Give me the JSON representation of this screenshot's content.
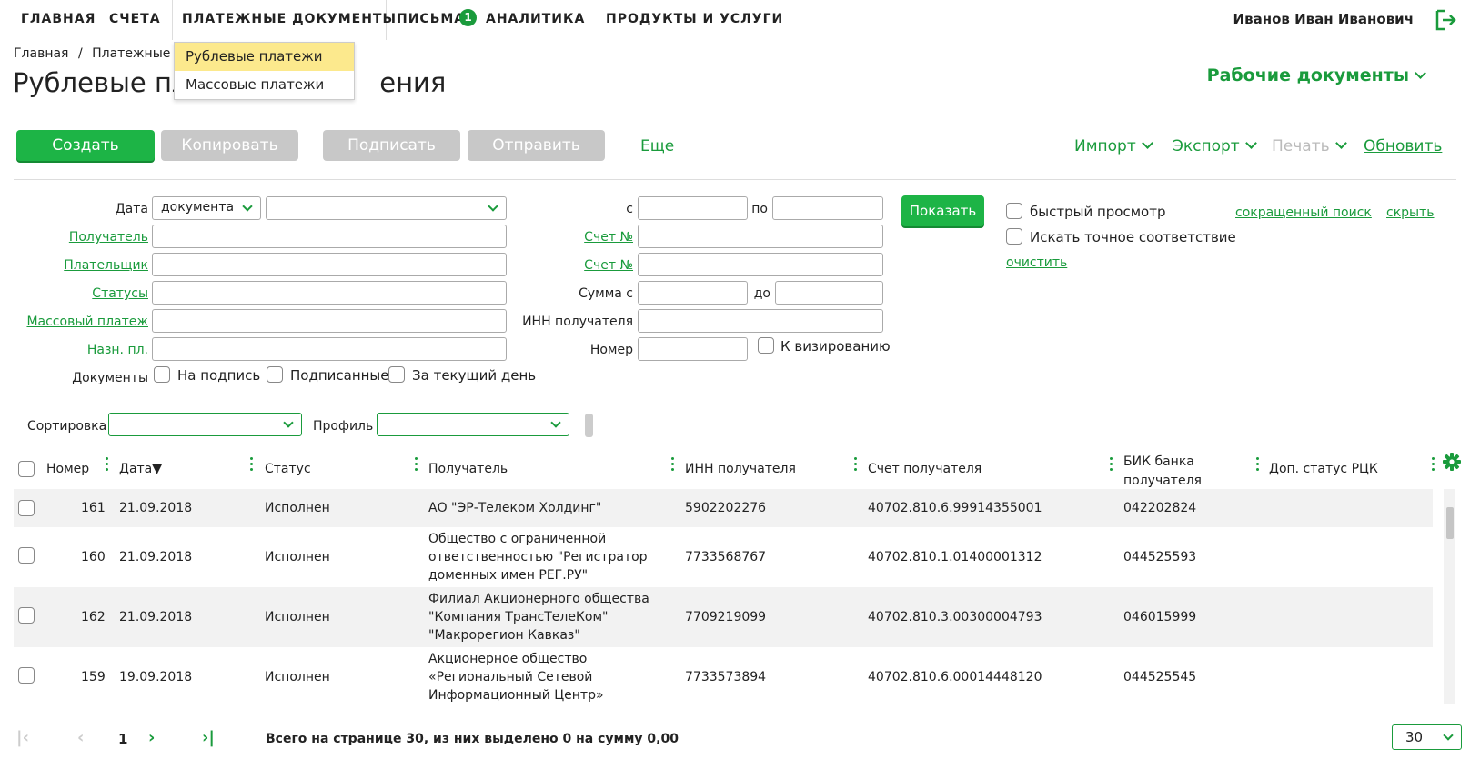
{
  "nav": {
    "items": [
      "ГЛАВНАЯ",
      "СЧЕТА",
      "ПЛАТЕЖНЫЕ ДОКУМЕНТЫ",
      "ПИСЬМА",
      "АНАЛИТИКА",
      "ПРОДУКТЫ И УСЛУГИ"
    ],
    "letters_badge": "1",
    "user": "Иванов Иван Иванович"
  },
  "dropdown": {
    "items": [
      "Рублевые платежи",
      "Массовые платежи"
    ]
  },
  "breadcrumb": {
    "home": "Главная",
    "sep": "/",
    "current": "Платежные д"
  },
  "page": {
    "title": "Рублевые пла",
    "title_tail": "ения",
    "workdocs": "Рабочие документы"
  },
  "toolbar": {
    "create": "Создать",
    "copy": "Копировать",
    "sign": "Подписать",
    "send": "Отправить",
    "more": "Еще",
    "import": "Импорт",
    "export": "Экспорт",
    "print": "Печать",
    "refresh": "Обновить"
  },
  "filters": {
    "date_label": "Дата",
    "date_type": "документа",
    "recipient": "Получатель",
    "payer": "Плательщик",
    "statuses": "Статусы",
    "mass_payment": "Массовый платеж",
    "purpose": "Назн. пл.",
    "documents_label": "Документы",
    "for_signing": "На подпись",
    "signed": "Подписанные",
    "today": "За текущий день",
    "from": "с",
    "to": "по",
    "account1": "Счет №",
    "account2": "Счет №",
    "sum_from": "Сумма с",
    "sum_to": "до",
    "inn": "ИНН получателя",
    "number": "Номер",
    "for_visa": "К визированию",
    "show": "Показать",
    "quick_view": "быстрый просмотр",
    "exact_match": "Искать точное соответствие",
    "clear": "очистить",
    "short_search": "сокращенный поиск",
    "hide": "скрыть"
  },
  "sort": {
    "sort_label": "Сортировка",
    "profile_label": "Профиль"
  },
  "table": {
    "headers": {
      "number": "Номер",
      "date": "Дата▼",
      "status": "Статус",
      "recipient": "Получатель",
      "inn": "ИНН получателя",
      "account": "Счет получателя",
      "bik1": "БИК банка",
      "bik2": "получателя",
      "extra": "Доп. статус РЦК"
    },
    "rows": [
      {
        "num": "161",
        "date": "21.09.2018",
        "status": "Исполнен",
        "recipient": [
          "АО \"ЭР-Телеком Холдинг\""
        ],
        "inn": "5902202276",
        "account": "40702.810.6.99914355001",
        "bik": "042202824"
      },
      {
        "num": "160",
        "date": "21.09.2018",
        "status": "Исполнен",
        "recipient": [
          "Общество с ограниченной",
          "ответственностью \"Регистратор",
          "доменных имен РЕГ.РУ\""
        ],
        "inn": "7733568767",
        "account": "40702.810.1.01400001312",
        "bik": "044525593"
      },
      {
        "num": "162",
        "date": "21.09.2018",
        "status": "Исполнен",
        "recipient": [
          "Филиал Акционерного общества",
          "\"Компания ТрансТелеКом\"",
          "\"Макрорегион Кавказ\""
        ],
        "inn": "7709219099",
        "account": "40702.810.3.00300004793",
        "bik": "046015999"
      },
      {
        "num": "159",
        "date": "19.09.2018",
        "status": "Исполнен",
        "recipient": [
          "Акционерное общество",
          "«Региональный Сетевой",
          "Информационный Центр»"
        ],
        "inn": "7733573894",
        "account": "40702.810.6.00014448120",
        "bik": "044525545"
      }
    ]
  },
  "footer": {
    "page": "1",
    "summary": "Всего на странице 30, из них выделено 0 на сумму 0,00",
    "page_size": "30"
  },
  "colors": {
    "accent": "#1a9b3c",
    "button": "#1db446",
    "highlight": "#fce98d"
  }
}
